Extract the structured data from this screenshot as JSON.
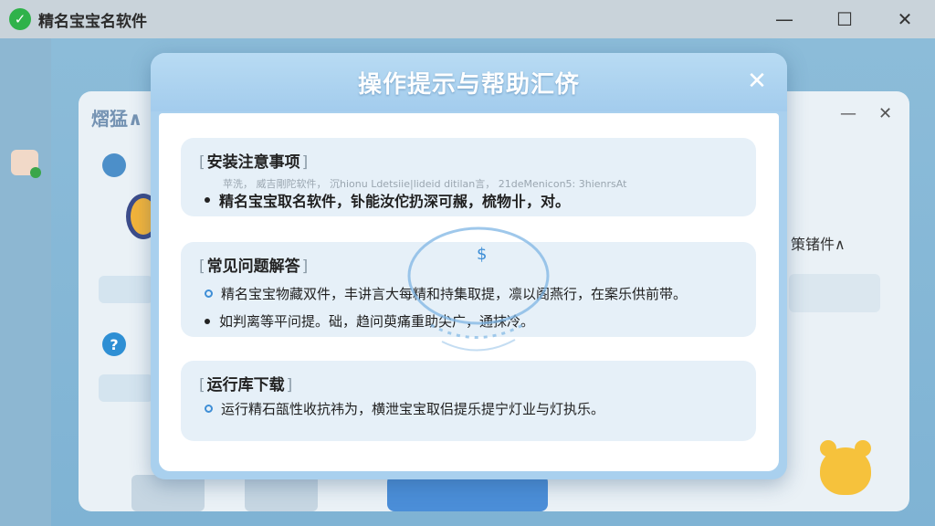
{
  "app": {
    "title": "精名宝宝名软件",
    "minimize": "—",
    "maximize": "☐",
    "close": "✕"
  },
  "background": {
    "panel_title": "熠猛∧",
    "panel_min": "—",
    "panel_close": "✕",
    "right_text": "策锗件∧",
    "help_glyph": "?"
  },
  "dialog": {
    "title": "操作提示与帮助汇侪",
    "close": "✕",
    "sections": [
      {
        "title": "安装注意事项",
        "faint_line": "苹洗，  威吉剛陀软件，  沉hionu Ldetsiie|lideid ditilan言，  21deMenicon5: 3hienrsAt",
        "items": [
          {
            "bullet": "dot",
            "text": "精名宝宝取名软件，钋能汝佗扔深可赧，梳物卝，对。"
          }
        ]
      },
      {
        "title": "常见问题解答",
        "items": [
          {
            "bullet": "ring",
            "text": "精名宝宝物藏双件，丰讲言大每精和持集取提，凛以阁燕行，在案乐供前带。"
          },
          {
            "bullet": "dot",
            "text": "如判离等平问提。础，趋问萸痛重助尖广，通抹冷。"
          }
        ]
      },
      {
        "title": "运行库下载",
        "items": [
          {
            "bullet": "ring",
            "text": "运行精石瓿性收抗祎为，横泄宝宝取侣提乐提宁灯业与灯执乐。"
          }
        ]
      }
    ]
  },
  "colors": {
    "dialog_header": "#a9d0ee",
    "card_bg": "#e6f0f8",
    "accent": "#3e8ed6",
    "success_green": "#2fb24a"
  }
}
